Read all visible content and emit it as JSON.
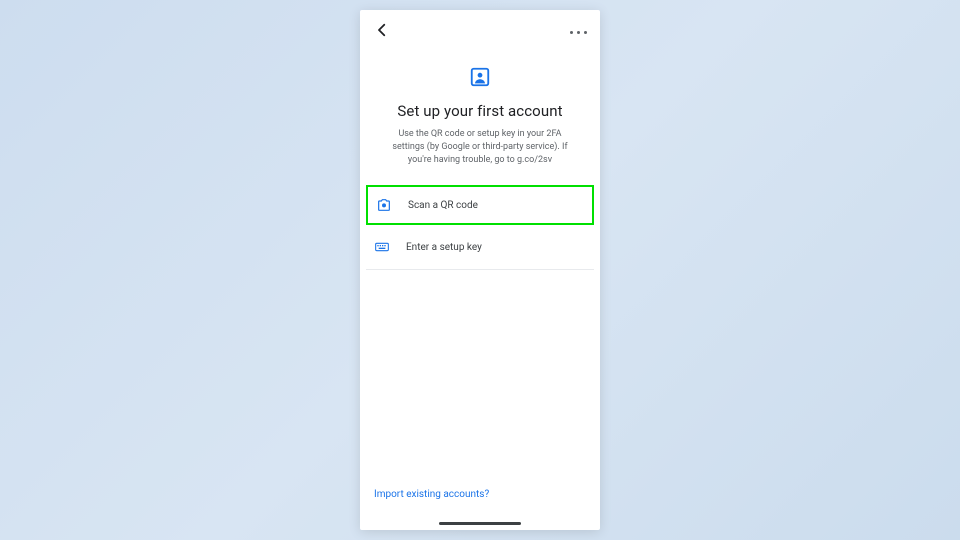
{
  "header": {
    "title": "Set up your first account",
    "subtitle": "Use the QR code or setup key in your 2FA settings (by Google or third-party service). If you're having trouble, go to g.co/2sv"
  },
  "options": {
    "scan": "Scan a QR code",
    "enter": "Enter a setup key"
  },
  "footer": {
    "import_link": "Import existing accounts?"
  },
  "colors": {
    "accent": "#1a73e8",
    "highlight": "#00e000"
  }
}
